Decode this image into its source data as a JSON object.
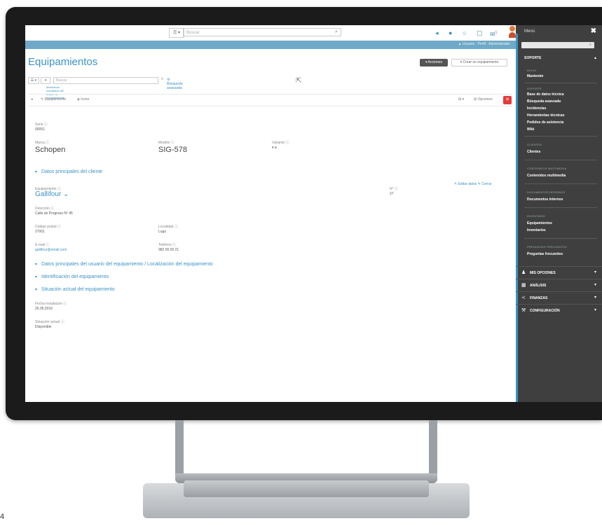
{
  "app": {
    "page_title": "Equipamientos",
    "corner_number": "4"
  },
  "topbar": {
    "combo_label": "☰ ▾",
    "search_placeholder": "Buscar",
    "search_icon": "search-icon",
    "icons": [
      "back-icon",
      "dot-icon",
      "circle-icon",
      "calendar-icon",
      "notification-icon"
    ],
    "notification_badge": "1"
  },
  "breadcrumb": "▲ Usuario · Perfil · Administrador",
  "header_buttons": {
    "primary": "▾ Acciones",
    "secondary": "▾ Crear un equipamiento"
  },
  "filter": {
    "select1": "☰ ▾",
    "select2": "▾",
    "search_placeholder": "Buscar",
    "search_icon": "search-icon",
    "advanced_label": "⚙ Búsqueda avanzada",
    "subline": "Mostrando resultados del listado de equipamientos"
  },
  "toolbar": {
    "back_label": "◂",
    "edit_label": "✎ Equipamiento",
    "item_label": "◈ Icono",
    "right_label1": "⊞ ▾",
    "right_label2": "⊞ Opciones",
    "delete_icon": "✕"
  },
  "record": {
    "serial_label": "Serie ⓘ",
    "serial_value": "00051",
    "brand_label": "Marca ⓘ",
    "brand_value": "Schopen",
    "model_label": "Modelo ⓘ",
    "model_value": "SIG-578",
    "variant_label": "Variante ⓘ",
    "variant_value": "▾ a",
    "right_links": "✎ Editar datos   ✎ Cerrar",
    "section_client": "Datos principales del cliente",
    "client_label": "Equipamiento ⓘ",
    "client_name": "Gallifour ⌄",
    "status_label": "N° ⓘ",
    "status_value": "27",
    "address_label": "Dirección ⓘ",
    "address_value": "Calle de Progreso Nº 45",
    "postal_label": "Código postal ⓘ",
    "postal_value": "27001",
    "city_label": "Localidad ⓘ",
    "city_value": "Lugo",
    "email_label": "E-mail ⓘ",
    "email_value": "gallifour@email.com",
    "phone_label": "Teléfono ⓘ",
    "phone_value": "982 00 00 21",
    "section_user": "Datos principales del usuario del equipamiento / Localización del equipamiento",
    "section_ident": "Identificación del equipamiento",
    "section_state": "Situación actual del equipamiento",
    "date_label": "Fecha instalación ⓘ",
    "date_value": "25.05.2016",
    "current_label": "Situación actual ⓘ",
    "current_value": "Disponible"
  },
  "sidemenu": {
    "title": "Menú",
    "close": "✖",
    "search_icon": "search-icon",
    "section": "SOPORTE",
    "groups": [
      {
        "label": "INICIO",
        "items": [
          "Mantenim"
        ]
      },
      {
        "label": "SOPORTE",
        "items": [
          "Base de datos técnica",
          "Búsqueda avanzada",
          "Incidencias",
          "Herramientas técnicas",
          "Pedidos de asistencia",
          "Wiki"
        ]
      },
      {
        "label": "CLIENTES",
        "items": [
          "Clientes"
        ]
      },
      {
        "label": "CONTENIDOS MULTIMEDIA",
        "items": [
          "Contenidos multimedia"
        ]
      },
      {
        "label": "DOCUMENTOS INTERNOS",
        "items": [
          "Documentos internos"
        ]
      },
      {
        "label": "INVENTARIO",
        "items": [
          "Equipamientos",
          "Inventarios"
        ]
      },
      {
        "label": "PREGUNTAS FRECUENTES",
        "items": [
          "Preguntas frecuentes"
        ]
      }
    ],
    "categories": [
      {
        "icon": "user-icon",
        "glyph": "♟",
        "label": "MIS OPCIONES"
      },
      {
        "icon": "chart-icon",
        "glyph": "▦",
        "label": "ANÁLISIS"
      },
      {
        "icon": "share-icon",
        "glyph": "≺",
        "label": "FINANZAS"
      },
      {
        "icon": "wrench-icon",
        "glyph": "⚒",
        "label": "CONFIGURACIÓN"
      }
    ],
    "colors": {
      "background": "#3f3f3f",
      "accent": "#3b93c4"
    }
  },
  "colors": {
    "accent": "#3b93c4",
    "header_band": "#6fa9c7",
    "danger": "#e63a3a"
  }
}
